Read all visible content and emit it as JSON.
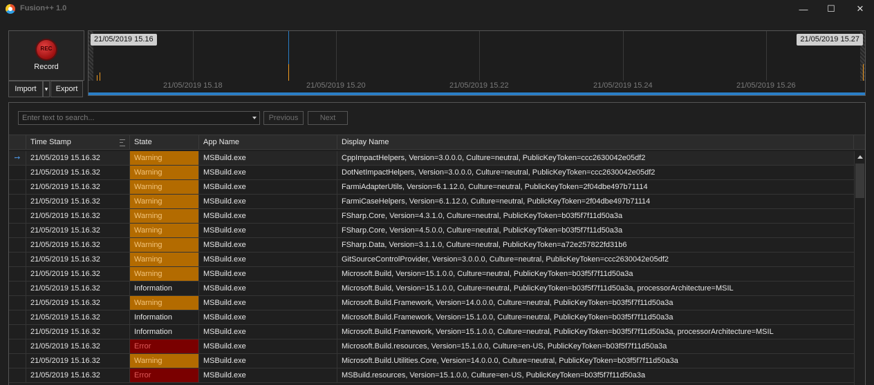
{
  "window": {
    "title": "Fusion++ 1.0",
    "minimize_glyph": "—",
    "maximize_glyph": "☐",
    "close_glyph": "✕"
  },
  "toolbar": {
    "record_label": "Record",
    "record_icon_text": "REC",
    "import_label": "Import",
    "import_dropdown_glyph": "▾",
    "export_label": "Export"
  },
  "timeline": {
    "start_label": "21/05/2019 15.16",
    "end_label": "21/05/2019 15.27",
    "axis_labels": [
      "21/05/2019 15.18",
      "21/05/2019 15.20",
      "21/05/2019 15.22",
      "21/05/2019 15.24",
      "21/05/2019 15.26"
    ]
  },
  "search": {
    "placeholder": "Enter text to search...",
    "previous_label": "Previous",
    "next_label": "Next"
  },
  "table": {
    "columns": [
      "Time Stamp",
      "State",
      "App Name",
      "Display Name"
    ],
    "current_row_glyph": "➙",
    "rows": [
      {
        "time": "21/05/2019 15.16.32",
        "state": "Warning",
        "app": "MSBuild.exe",
        "display": "CppImpactHelpers, Version=3.0.0.0, Culture=neutral, PublicKeyToken=ccc2630042e05df2"
      },
      {
        "time": "21/05/2019 15.16.32",
        "state": "Warning",
        "app": "MSBuild.exe",
        "display": "DotNetImpactHelpers, Version=3.0.0.0, Culture=neutral, PublicKeyToken=ccc2630042e05df2"
      },
      {
        "time": "21/05/2019 15.16.32",
        "state": "Warning",
        "app": "MSBuild.exe",
        "display": "FarmiAdapterUtils, Version=6.1.12.0, Culture=neutral, PublicKeyToken=2f04dbe497b71114"
      },
      {
        "time": "21/05/2019 15.16.32",
        "state": "Warning",
        "app": "MSBuild.exe",
        "display": "FarmiCaseHelpers, Version=6.1.12.0, Culture=neutral, PublicKeyToken=2f04dbe497b71114"
      },
      {
        "time": "21/05/2019 15.16.32",
        "state": "Warning",
        "app": "MSBuild.exe",
        "display": "FSharp.Core, Version=4.3.1.0, Culture=neutral, PublicKeyToken=b03f5f7f11d50a3a"
      },
      {
        "time": "21/05/2019 15.16.32",
        "state": "Warning",
        "app": "MSBuild.exe",
        "display": "FSharp.Core, Version=4.5.0.0, Culture=neutral, PublicKeyToken=b03f5f7f11d50a3a"
      },
      {
        "time": "21/05/2019 15.16.32",
        "state": "Warning",
        "app": "MSBuild.exe",
        "display": "FSharp.Data, Version=3.1.1.0, Culture=neutral, PublicKeyToken=a72e257822fd31b6"
      },
      {
        "time": "21/05/2019 15.16.32",
        "state": "Warning",
        "app": "MSBuild.exe",
        "display": "GitSourceControlProvider, Version=3.0.0.0, Culture=neutral, PublicKeyToken=ccc2630042e05df2"
      },
      {
        "time": "21/05/2019 15.16.32",
        "state": "Warning",
        "app": "MSBuild.exe",
        "display": "Microsoft.Build, Version=15.1.0.0, Culture=neutral, PublicKeyToken=b03f5f7f11d50a3a"
      },
      {
        "time": "21/05/2019 15.16.32",
        "state": "Information",
        "app": "MSBuild.exe",
        "display": "Microsoft.Build, Version=15.1.0.0, Culture=neutral, PublicKeyToken=b03f5f7f11d50a3a, processorArchitecture=MSIL"
      },
      {
        "time": "21/05/2019 15.16.32",
        "state": "Warning",
        "app": "MSBuild.exe",
        "display": "Microsoft.Build.Framework, Version=14.0.0.0, Culture=neutral, PublicKeyToken=b03f5f7f11d50a3a"
      },
      {
        "time": "21/05/2019 15.16.32",
        "state": "Information",
        "app": "MSBuild.exe",
        "display": "Microsoft.Build.Framework, Version=15.1.0.0, Culture=neutral, PublicKeyToken=b03f5f7f11d50a3a"
      },
      {
        "time": "21/05/2019 15.16.32",
        "state": "Information",
        "app": "MSBuild.exe",
        "display": "Microsoft.Build.Framework, Version=15.1.0.0, Culture=neutral, PublicKeyToken=b03f5f7f11d50a3a, processorArchitecture=MSIL"
      },
      {
        "time": "21/05/2019 15.16.32",
        "state": "Error",
        "app": "MSBuild.exe",
        "display": "Microsoft.Build.resources, Version=15.1.0.0, Culture=en-US, PublicKeyToken=b03f5f7f11d50a3a"
      },
      {
        "time": "21/05/2019 15.16.32",
        "state": "Warning",
        "app": "MSBuild.exe",
        "display": "Microsoft.Build.Utilities.Core, Version=14.0.0.0, Culture=neutral, PublicKeyToken=b03f5f7f11d50a3a"
      },
      {
        "time": "21/05/2019 15.16.32",
        "state": "Error",
        "app": "MSBuild.exe",
        "display": "MSBuild.resources, Version=15.1.0.0, Culture=en-US, PublicKeyToken=b03f5f7f11d50a3a"
      }
    ]
  },
  "colors": {
    "warning": "#b36b00",
    "error": "#7a0000",
    "timeline_bar": "#2a7ec6",
    "timeline_tick": "#f09a20"
  }
}
